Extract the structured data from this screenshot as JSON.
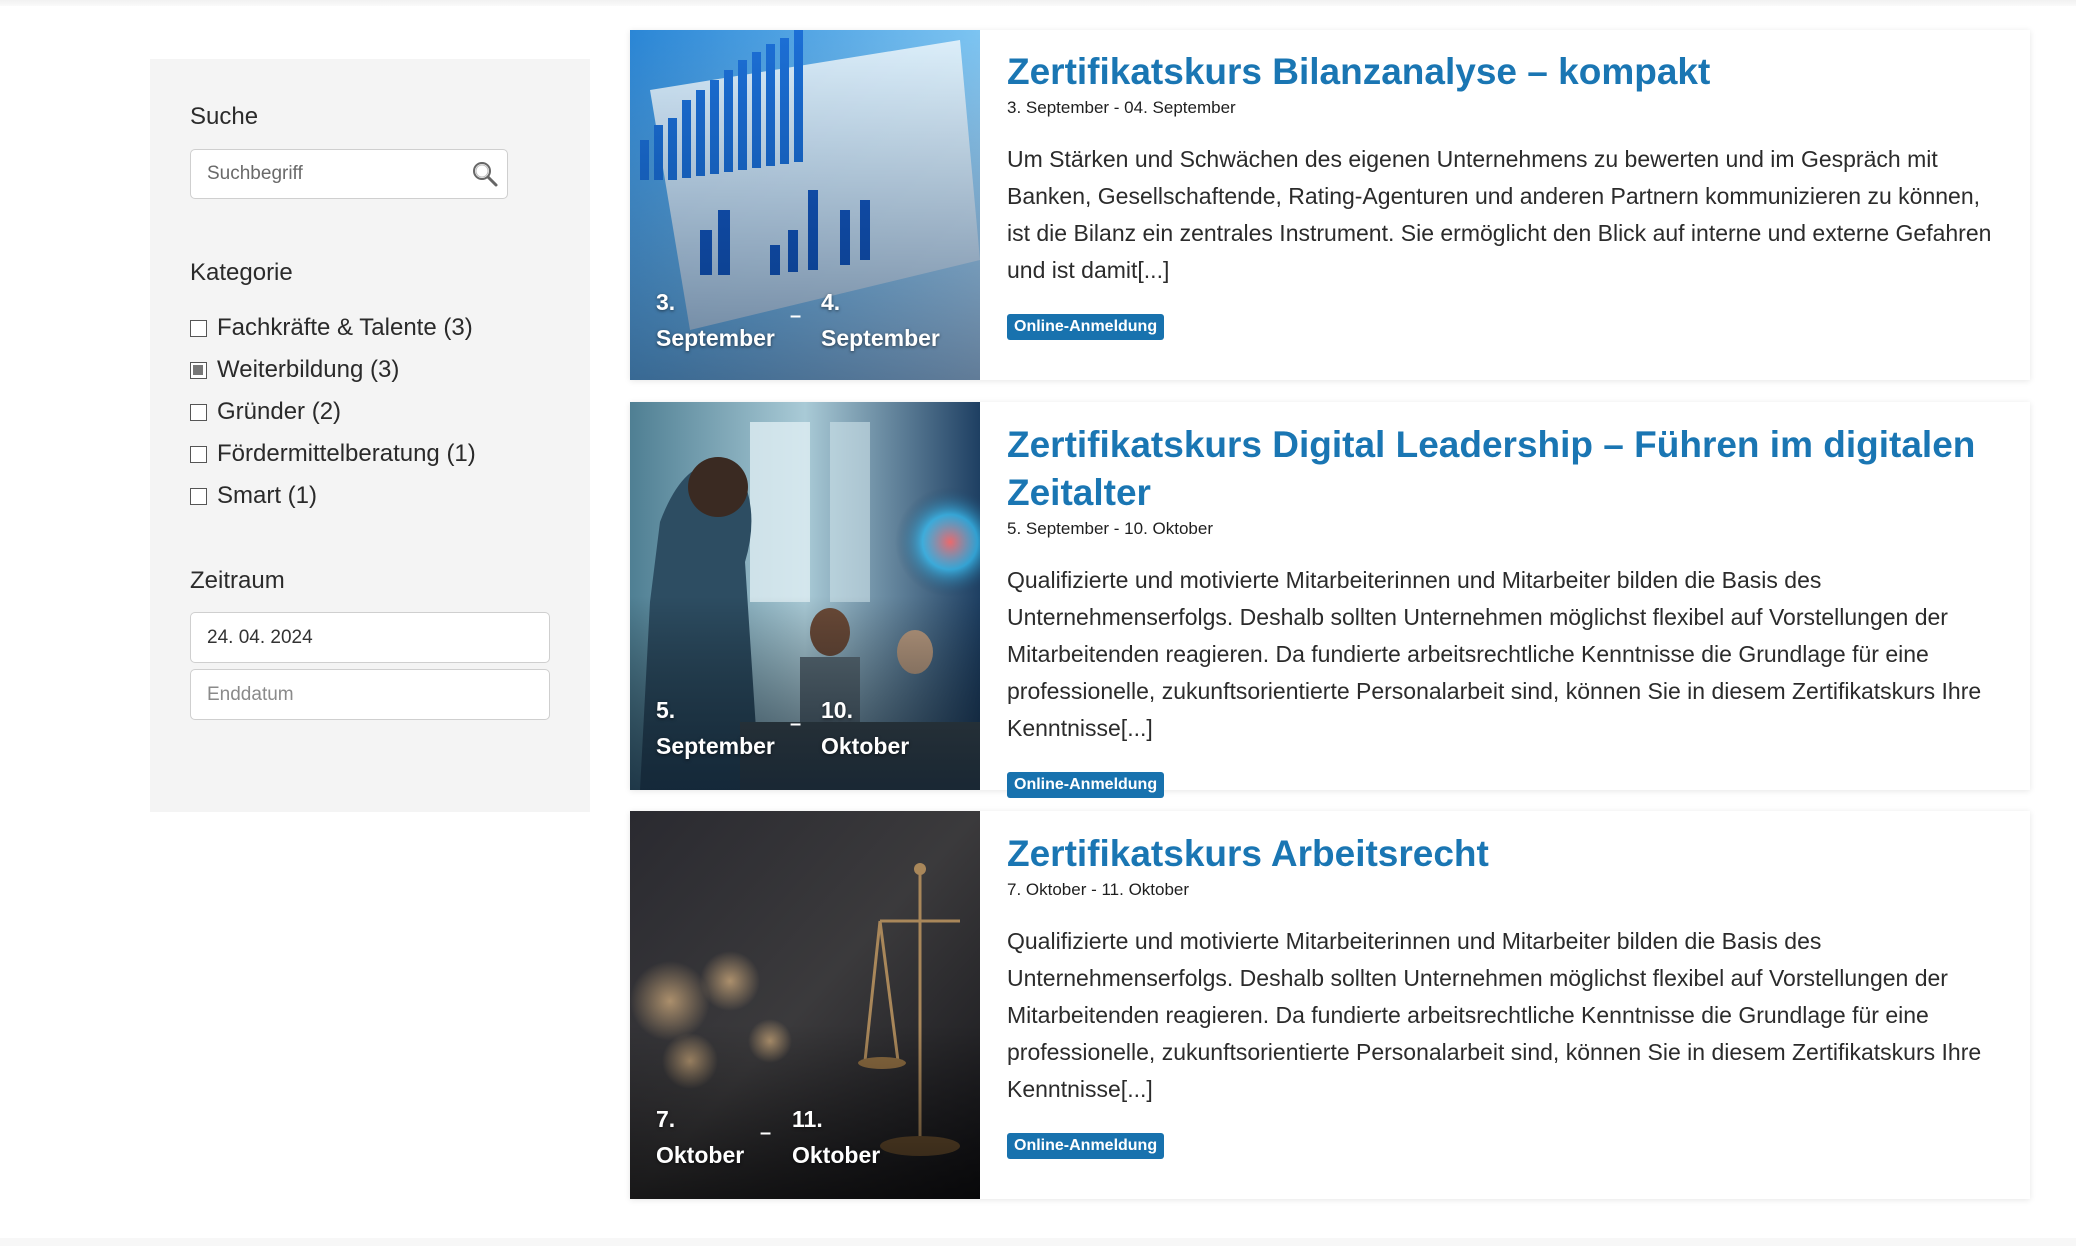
{
  "sidebar": {
    "search_heading": "Suche",
    "search_placeholder": "Suchbegriff",
    "category_heading": "Kategorie",
    "categories": [
      {
        "label": "Fachkräfte & Talente (3)",
        "checked": false
      },
      {
        "label": "Weiterbildung (3)",
        "checked": true
      },
      {
        "label": "Gründer (2)",
        "checked": false
      },
      {
        "label": "Fördermittelberatung (1)",
        "checked": false
      },
      {
        "label": "Smart (1)",
        "checked": false
      }
    ],
    "period_heading": "Zeitraum",
    "start_date_value": "24. 04. 2024",
    "end_date_placeholder": "Enddatum"
  },
  "events": [
    {
      "title": "Zertifikatskurs Bilanzanalyse – kompakt",
      "date_range": "3. September - 04. September",
      "start_day": "3.",
      "start_month": "September",
      "end_day": "4.",
      "end_month": "September",
      "description": "Um Stärken und Schwächen des eigenen Unternehmens zu bewerten und im Gespräch mit Banken, Gesellschaftende, Rating-Agenturen und anderen Partnern kommunizieren zu können, ist die Bilanz ein zentrales Instrument. Sie ermöglicht den Blick auf interne und externe Gefahren und ist damit[...]",
      "badge": "Online-Anmeldung"
    },
    {
      "title": "Zertifikatskurs Digital Leadership – Führen im digitalen Zeitalter",
      "date_range": "5. September - 10. Oktober",
      "start_day": "5.",
      "start_month": "September",
      "end_day": "10.",
      "end_month": "Oktober",
      "description": "Qualifizierte und motivierte Mitarbeiterinnen und Mitarbeiter bilden die Basis des Unternehmenserfolgs. Deshalb sollten Unternehmen möglichst flexibel auf Vorstellungen der Mitarbeitenden reagieren. Da fundierte arbeitsrechtliche Kenntnisse die Grundlage für eine professionelle, zukunftsorientierte Personalarbeit sind, können Sie in diesem Zertifikatskurs Ihre Kenntnisse[...]",
      "badge": "Online-Anmeldung"
    },
    {
      "title": "Zertifikatskurs Arbeitsrecht",
      "date_range": "7. Oktober - 11. Oktober",
      "start_day": "7.",
      "start_month": "Oktober",
      "end_day": "11.",
      "end_month": "Oktober",
      "description": "Qualifizierte und motivierte Mitarbeiterinnen und Mitarbeiter bilden die Basis des Unternehmenserfolgs. Deshalb sollten Unternehmen möglichst flexibel auf Vorstellungen der Mitarbeitenden reagieren. Da fundierte arbeitsrechtliche Kenntnisse die Grundlage für eine professionelle, zukunftsorientierte Personalarbeit sind, können Sie in diesem Zertifikatskurs Ihre Kenntnisse[...]",
      "badge": "Online-Anmeldung"
    }
  ],
  "date_separator": "–",
  "colors": {
    "accent": "#1a76b3",
    "badge": "#1872ae",
    "sidebar_bg": "#f4f4f4"
  },
  "icons": {
    "search": "magnifier-icon"
  }
}
